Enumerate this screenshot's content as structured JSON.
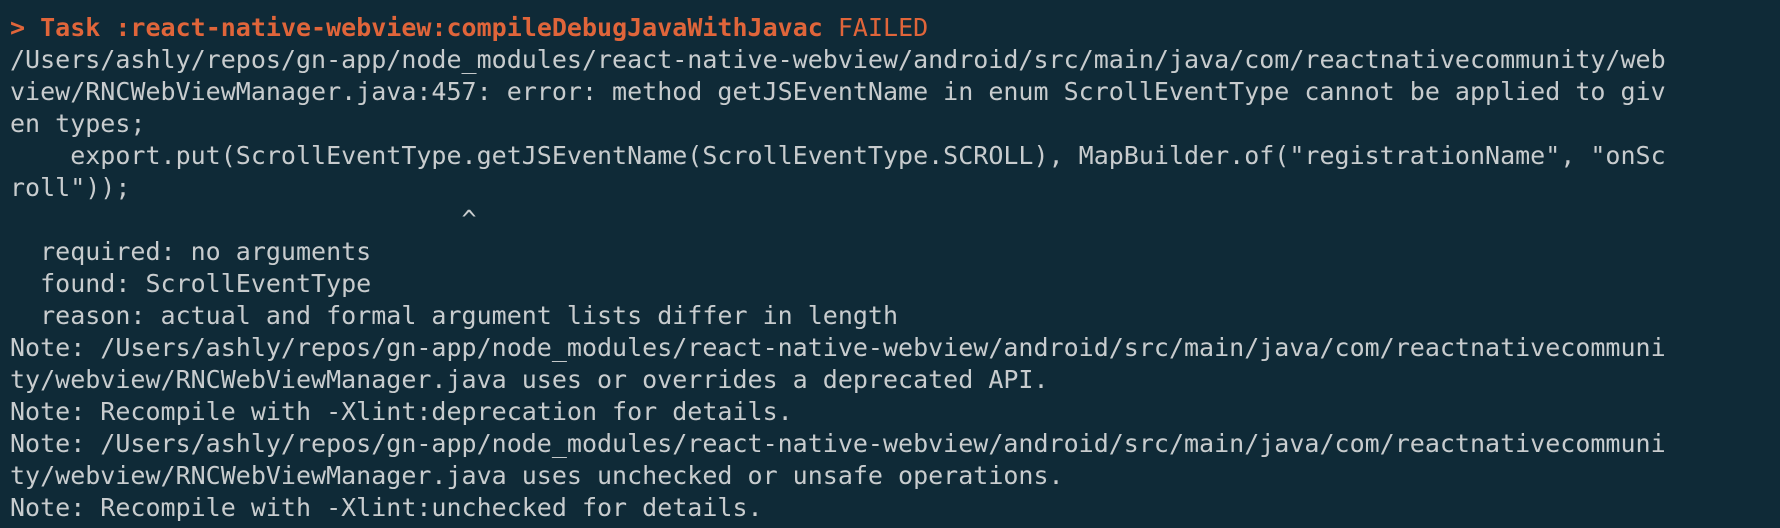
{
  "terminal": {
    "colors": {
      "background": "#0f2a37",
      "text": "#c8ccce",
      "error_accent": "#e0653a"
    },
    "task_line": {
      "prompt": ">",
      "task": "Task :react-native-webview:compileDebugJavaWithJavac",
      "status": "FAILED"
    },
    "lines": [
      "/Users/ashly/repos/gn-app/node_modules/react-native-webview/android/src/main/java/com/reactnativecommunity/web",
      "view/RNCWebViewManager.java:457: error: method getJSEventName in enum ScrollEventType cannot be applied to giv",
      "en types;",
      "    export.put(ScrollEventType.getJSEventName(ScrollEventType.SCROLL), MapBuilder.of(\"registrationName\", \"onSc",
      "roll\"));",
      "                              ^",
      "  required: no arguments",
      "  found: ScrollEventType",
      "  reason: actual and formal argument lists differ in length",
      "Note: /Users/ashly/repos/gn-app/node_modules/react-native-webview/android/src/main/java/com/reactnativecommuni",
      "ty/webview/RNCWebViewManager.java uses or overrides a deprecated API.",
      "Note: Recompile with -Xlint:deprecation for details.",
      "Note: /Users/ashly/repos/gn-app/node_modules/react-native-webview/android/src/main/java/com/reactnativecommuni",
      "ty/webview/RNCWebViewManager.java uses unchecked or unsafe operations.",
      "Note: Recompile with -Xlint:unchecked for details."
    ]
  }
}
